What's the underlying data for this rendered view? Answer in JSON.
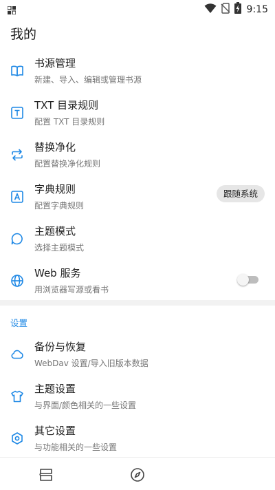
{
  "status_bar": {
    "time": "9:15",
    "icons": [
      "notification-icon",
      "wifi-icon",
      "no-sim-icon",
      "battery-charging-icon"
    ]
  },
  "page_title": "我的",
  "items": [
    {
      "icon": "book-icon",
      "title": "书源管理",
      "summary": "新建、导入、编辑或管理书源"
    },
    {
      "icon": "txt-icon",
      "title": "TXT 目录规则",
      "summary": "配置 TXT 目录规则"
    },
    {
      "icon": "replace-icon",
      "title": "替换净化",
      "summary": "配置替换净化规则"
    },
    {
      "icon": "dictionary-icon",
      "title": "字典规则",
      "summary": "配置字典规则"
    },
    {
      "icon": "theme-mode-icon",
      "title": "主题模式",
      "summary": "选择主题模式",
      "value": "跟随系统"
    },
    {
      "icon": "globe-icon",
      "title": "Web 服务",
      "summary": "用浏览器写源或看书",
      "switch_on": false
    }
  ],
  "settings_header": "设置",
  "settings_items": [
    {
      "icon": "cloud-icon",
      "title": "备份与恢复",
      "summary": "WebDav 设置/导入旧版本数据"
    },
    {
      "icon": "shirt-icon",
      "title": "主题设置",
      "summary": "与界面/颜色相关的一些设置"
    },
    {
      "icon": "settings-icon",
      "title": "其它设置",
      "summary": "与功能相关的一些设置"
    }
  ],
  "bottom_nav": [
    "bookshelf-icon",
    "explore-icon"
  ],
  "colors": {
    "icon": "#1e88e5",
    "section_header": "#1e88e5",
    "chip_bg": "#e6e6e6",
    "divider": "#f2f2f2"
  }
}
